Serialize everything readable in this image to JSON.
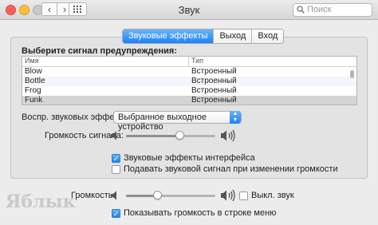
{
  "window": {
    "title": "Звук"
  },
  "search": {
    "placeholder": "Поиск"
  },
  "tabs": [
    {
      "label": "Звуковые эффекты",
      "active": true
    },
    {
      "label": "Выход",
      "active": false
    },
    {
      "label": "Вход",
      "active": false
    }
  ],
  "alert": {
    "heading": "Выберите сигнал предупреждения:",
    "columns": [
      "Имя",
      "Тип"
    ],
    "rows": [
      {
        "name": "Blow",
        "type": "Встроенный"
      },
      {
        "name": "Bottle",
        "type": "Встроенный"
      },
      {
        "name": "Frog",
        "type": "Встроенный"
      },
      {
        "name": "Funk",
        "type": "Встроенный"
      }
    ],
    "selected": "Funk"
  },
  "output_device": {
    "label": "Воспр. звуковых эффектов:",
    "value": "Выбранное выходное устройство"
  },
  "alert_volume": {
    "label": "Громкость сигнала:",
    "level": 0.6
  },
  "checkboxes": [
    {
      "label": "Звуковые эффекты интерфейса",
      "checked": true
    },
    {
      "label": "Подавать звуковой сигнал при изменении громкости",
      "checked": false
    }
  ],
  "volume": {
    "label": "Громкость:",
    "level": 0.35,
    "mute_label": "Выкл. звук",
    "muted": false
  },
  "menubar_checkbox": {
    "label": "Показывать громкость в строке меню",
    "checked": true
  },
  "watermark": "Яблык",
  "colors": {
    "accent": "#1a82fb",
    "selection": "#d4d4d4"
  }
}
